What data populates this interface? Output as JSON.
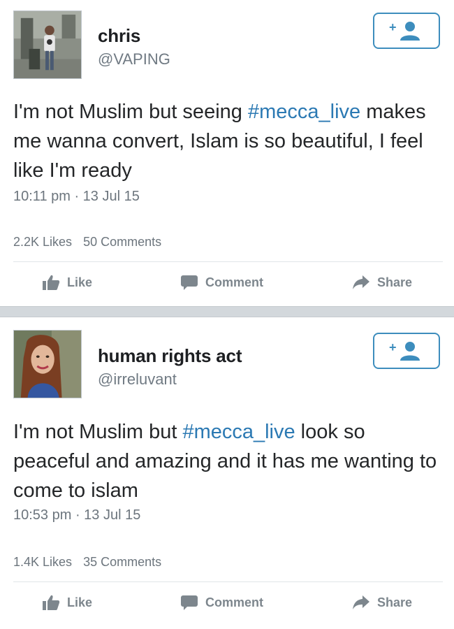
{
  "posts": [
    {
      "name": "chris",
      "handle": "@VAPING",
      "text_before": "I'm not Muslim but seeing ",
      "hashtag": "#mecca_live",
      "text_after": " makes me wanna convert, Islam is so beautiful, I feel like I'm ready",
      "timestamp": "10:11 pm · 13 Jul 15",
      "likes": "2.2K Likes",
      "comments": "50 Comments",
      "actions": {
        "like": "Like",
        "comment": "Comment",
        "share": "Share"
      }
    },
    {
      "name": "human rights act",
      "handle": "@irreluvant",
      "text_before": "I'm not Muslim but ",
      "hashtag": "#mecca_live",
      "text_after": " look so peaceful and amazing and it has me wanting to come to islam",
      "timestamp": "10:53 pm · 13 Jul 15",
      "likes": "1.4K Likes",
      "comments": "35 Comments",
      "actions": {
        "like": "Like",
        "comment": "Comment",
        "share": "Share"
      }
    }
  ],
  "colors": {
    "accent": "#3d8dbd",
    "hashtag": "#2b79b3",
    "muted": "#6c757d",
    "separator": "#d3d8dc"
  },
  "icons": {
    "follow": "add-user-icon",
    "like": "thumbs-up-icon",
    "comment": "comment-bubble-icon",
    "share": "share-arrow-icon"
  }
}
